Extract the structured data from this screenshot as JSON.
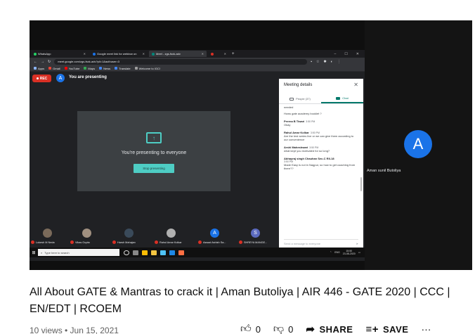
{
  "browser": {
    "tabs": [
      {
        "label": "WhatsApp",
        "color": "#25d366"
      },
      {
        "label": "Google meet link for webinar on",
        "color": "#1a73e8"
      },
      {
        "label": "Meet - zgs-fsxk-adv",
        "color": "#00897b",
        "active": true
      },
      {
        "label": "",
        "color": "#d93025"
      }
    ],
    "url": "meet.google.com/zgs-fsxk-adv?pli=1&authuser=3",
    "bookmarks": [
      "Apps",
      "Gmail",
      "YouTube",
      "Maps",
      "News",
      "Translate",
      "Welcome to IGC!"
    ]
  },
  "meet": {
    "rec_label": "REC",
    "presenter_avatar": "A",
    "presenting_text": "You are presenting",
    "present_message": "You're presenting to everyone",
    "stop_button": "Stop presenting"
  },
  "panel": {
    "title": "Meeting details",
    "tab_people": "People (37)",
    "tab_chat": "Chat",
    "messages": [
      {
        "sender": "",
        "time": "",
        "body": "needed"
      },
      {
        "sender": "",
        "time": "",
        "body": "Hows gate academy booklet ?"
      },
      {
        "sender": "Prerna B Tiwari",
        "time": "3:50 PM",
        "body": "Okay"
      },
      {
        "sender": "Rahul Amar Kolkar",
        "time": "3:50 PM",
        "body": "Are the test series live or we can give them according to our convenience"
      },
      {
        "sender": "Arshi Maheshwari",
        "time": "3:50 PM",
        "body": "what kept you motivated for so long?"
      },
      {
        "sender": "Abhayraj singh Chauhan Sec-C Rll-18",
        "time": "3:50 PM",
        "body": "Made Easy is not in Nagpur, so how to get coaching from there??"
      }
    ],
    "input_placeholder": "Send a message to everyone"
  },
  "participants": [
    {
      "name": "Lokesh M Neda",
      "initial": ""
    },
    {
      "name": "Vikas Gupta",
      "initial": ""
    },
    {
      "name": "Harsh Mahajan",
      "initial": ""
    },
    {
      "name": "Rahul Amar Kolkar",
      "initial": ""
    },
    {
      "name": "Aswad Ashish Sa...",
      "initial": "A",
      "color": "#1a73e8"
    },
    {
      "name": "SHREYA MANGE...",
      "initial": "S",
      "color": "#5c6bc0"
    }
  ],
  "taskbar": {
    "search_placeholder": "Type here to search",
    "lang": "ENG",
    "time": "15:50",
    "date": "23-08-2020"
  },
  "right_tile": {
    "avatar": "A",
    "name": "Aman sunil Butoliya"
  },
  "video": {
    "title": "All About GATE & Mantras to crack it | Aman Butoliya | AIR 446 - GATE 2020 | CCC | EN/EDT | RCOEM",
    "meta": "10 views • Jun 15, 2021",
    "likes": "0",
    "dislikes": "0",
    "share_label": "SHARE",
    "save_label": "SAVE"
  }
}
